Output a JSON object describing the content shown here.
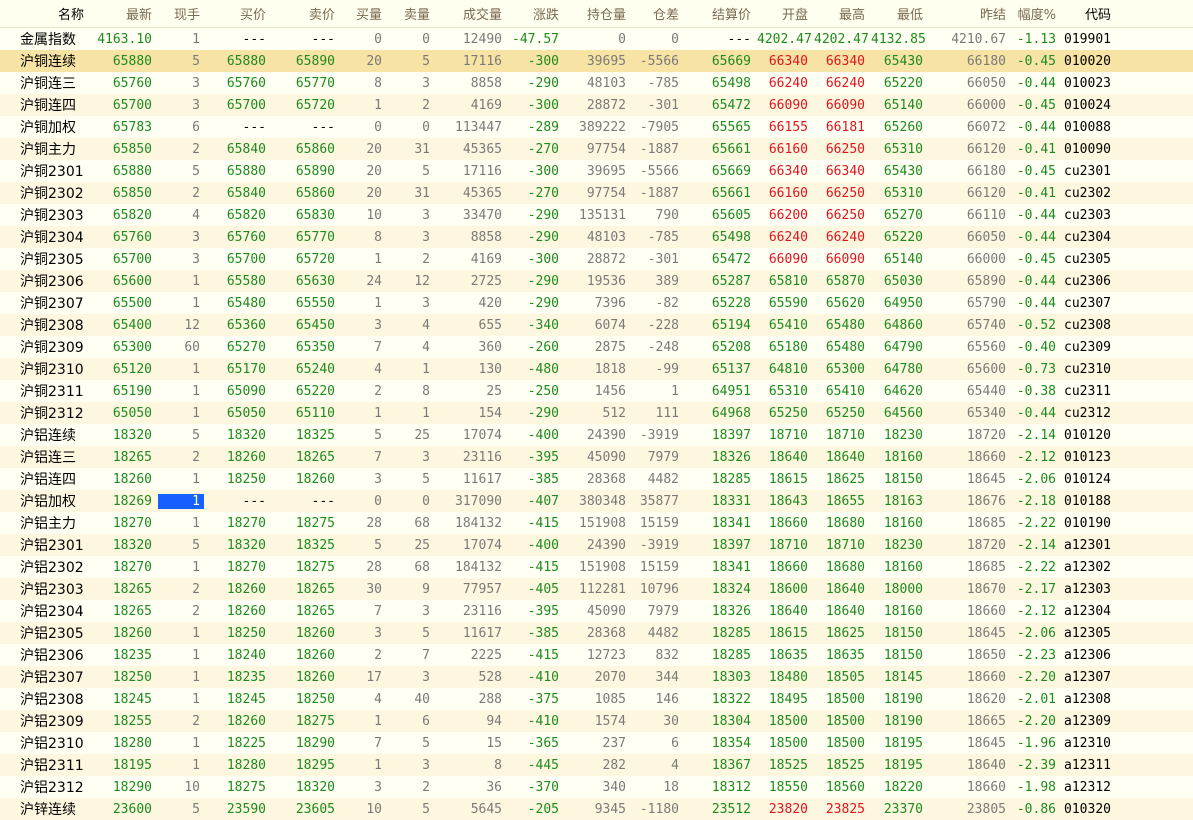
{
  "columns": [
    "名称",
    "最新",
    "现手",
    "买价",
    "卖价",
    "买量",
    "卖量",
    "成交量",
    "涨跌",
    "持仓量",
    "仓差",
    "结算价",
    "开盘",
    "最高",
    "最低",
    "昨结",
    "幅度%",
    "代码"
  ],
  "rows": [
    {
      "name": "金属指数",
      "last": "4163.10",
      "vol_now": "1",
      "bid": "---",
      "ask": "---",
      "bid_qty": "0",
      "ask_qty": "0",
      "volume": "12490",
      "change": "-47.57",
      "oi": "0",
      "oi_diff": "0",
      "settle": "---",
      "open": "4202.47",
      "high": "4202.47",
      "low": "4132.85",
      "prev_settle": "4210.67",
      "pct": "-1.13",
      "code": "019901"
    },
    {
      "name": "沪铜连续",
      "last": "65880",
      "vol_now": "5",
      "bid": "65880",
      "ask": "65890",
      "bid_qty": "20",
      "ask_qty": "5",
      "volume": "17116",
      "change": "-300",
      "oi": "39695",
      "oi_diff": "-5566",
      "settle": "65669",
      "open": "66340",
      "high": "66340",
      "low": "65430",
      "prev_settle": "66180",
      "pct": "-0.45",
      "code": "010020"
    },
    {
      "name": "沪铜连三",
      "last": "65760",
      "vol_now": "3",
      "bid": "65760",
      "ask": "65770",
      "bid_qty": "8",
      "ask_qty": "3",
      "volume": "8858",
      "change": "-290",
      "oi": "48103",
      "oi_diff": "-785",
      "settle": "65498",
      "open": "66240",
      "high": "66240",
      "low": "65220",
      "prev_settle": "66050",
      "pct": "-0.44",
      "code": "010023"
    },
    {
      "name": "沪铜连四",
      "last": "65700",
      "vol_now": "3",
      "bid": "65700",
      "ask": "65720",
      "bid_qty": "1",
      "ask_qty": "2",
      "volume": "4169",
      "change": "-300",
      "oi": "28872",
      "oi_diff": "-301",
      "settle": "65472",
      "open": "66090",
      "high": "66090",
      "low": "65140",
      "prev_settle": "66000",
      "pct": "-0.45",
      "code": "010024"
    },
    {
      "name": "沪铜加权",
      "last": "65783",
      "vol_now": "6",
      "bid": "---",
      "ask": "---",
      "bid_qty": "0",
      "ask_qty": "0",
      "volume": "113447",
      "change": "-289",
      "oi": "389222",
      "oi_diff": "-7905",
      "settle": "65565",
      "open": "66155",
      "high": "66181",
      "low": "65260",
      "prev_settle": "66072",
      "pct": "-0.44",
      "code": "010088"
    },
    {
      "name": "沪铜主力",
      "last": "65850",
      "vol_now": "2",
      "bid": "65840",
      "ask": "65860",
      "bid_qty": "20",
      "ask_qty": "31",
      "volume": "45365",
      "change": "-270",
      "oi": "97754",
      "oi_diff": "-1887",
      "settle": "65661",
      "open": "66160",
      "high": "66250",
      "low": "65310",
      "prev_settle": "66120",
      "pct": "-0.41",
      "code": "010090"
    },
    {
      "name": "沪铜2301",
      "last": "65880",
      "vol_now": "5",
      "bid": "65880",
      "ask": "65890",
      "bid_qty": "20",
      "ask_qty": "5",
      "volume": "17116",
      "change": "-300",
      "oi": "39695",
      "oi_diff": "-5566",
      "settle": "65669",
      "open": "66340",
      "high": "66340",
      "low": "65430",
      "prev_settle": "66180",
      "pct": "-0.45",
      "code": "cu2301"
    },
    {
      "name": "沪铜2302",
      "last": "65850",
      "vol_now": "2",
      "bid": "65840",
      "ask": "65860",
      "bid_qty": "20",
      "ask_qty": "31",
      "volume": "45365",
      "change": "-270",
      "oi": "97754",
      "oi_diff": "-1887",
      "settle": "65661",
      "open": "66160",
      "high": "66250",
      "low": "65310",
      "prev_settle": "66120",
      "pct": "-0.41",
      "code": "cu2302"
    },
    {
      "name": "沪铜2303",
      "last": "65820",
      "vol_now": "4",
      "bid": "65820",
      "ask": "65830",
      "bid_qty": "10",
      "ask_qty": "3",
      "volume": "33470",
      "change": "-290",
      "oi": "135131",
      "oi_diff": "790",
      "settle": "65605",
      "open": "66200",
      "high": "66250",
      "low": "65270",
      "prev_settle": "66110",
      "pct": "-0.44",
      "code": "cu2303"
    },
    {
      "name": "沪铜2304",
      "last": "65760",
      "vol_now": "3",
      "bid": "65760",
      "ask": "65770",
      "bid_qty": "8",
      "ask_qty": "3",
      "volume": "8858",
      "change": "-290",
      "oi": "48103",
      "oi_diff": "-785",
      "settle": "65498",
      "open": "66240",
      "high": "66240",
      "low": "65220",
      "prev_settle": "66050",
      "pct": "-0.44",
      "code": "cu2304"
    },
    {
      "name": "沪铜2305",
      "last": "65700",
      "vol_now": "3",
      "bid": "65700",
      "ask": "65720",
      "bid_qty": "1",
      "ask_qty": "2",
      "volume": "4169",
      "change": "-300",
      "oi": "28872",
      "oi_diff": "-301",
      "settle": "65472",
      "open": "66090",
      "high": "66090",
      "low": "65140",
      "prev_settle": "66000",
      "pct": "-0.45",
      "code": "cu2305"
    },
    {
      "name": "沪铜2306",
      "last": "65600",
      "vol_now": "1",
      "bid": "65580",
      "ask": "65630",
      "bid_qty": "24",
      "ask_qty": "12",
      "volume": "2725",
      "change": "-290",
      "oi": "19536",
      "oi_diff": "389",
      "settle": "65287",
      "open": "65810",
      "high": "65870",
      "low": "65030",
      "prev_settle": "65890",
      "pct": "-0.44",
      "code": "cu2306"
    },
    {
      "name": "沪铜2307",
      "last": "65500",
      "vol_now": "1",
      "bid": "65480",
      "ask": "65550",
      "bid_qty": "1",
      "ask_qty": "3",
      "volume": "420",
      "change": "-290",
      "oi": "7396",
      "oi_diff": "-82",
      "settle": "65228",
      "open": "65590",
      "high": "65620",
      "low": "64950",
      "prev_settle": "65790",
      "pct": "-0.44",
      "code": "cu2307"
    },
    {
      "name": "沪铜2308",
      "last": "65400",
      "vol_now": "12",
      "bid": "65360",
      "ask": "65450",
      "bid_qty": "3",
      "ask_qty": "4",
      "volume": "655",
      "change": "-340",
      "oi": "6074",
      "oi_diff": "-228",
      "settle": "65194",
      "open": "65410",
      "high": "65480",
      "low": "64860",
      "prev_settle": "65740",
      "pct": "-0.52",
      "code": "cu2308"
    },
    {
      "name": "沪铜2309",
      "last": "65300",
      "vol_now": "60",
      "bid": "65270",
      "ask": "65350",
      "bid_qty": "7",
      "ask_qty": "4",
      "volume": "360",
      "change": "-260",
      "oi": "2875",
      "oi_diff": "-248",
      "settle": "65208",
      "open": "65180",
      "high": "65480",
      "low": "64790",
      "prev_settle": "65560",
      "pct": "-0.40",
      "code": "cu2309"
    },
    {
      "name": "沪铜2310",
      "last": "65120",
      "vol_now": "1",
      "bid": "65170",
      "ask": "65240",
      "bid_qty": "4",
      "ask_qty": "1",
      "volume": "130",
      "change": "-480",
      "oi": "1818",
      "oi_diff": "-99",
      "settle": "65137",
      "open": "64810",
      "high": "65300",
      "low": "64780",
      "prev_settle": "65600",
      "pct": "-0.73",
      "code": "cu2310"
    },
    {
      "name": "沪铜2311",
      "last": "65190",
      "vol_now": "1",
      "bid": "65090",
      "ask": "65220",
      "bid_qty": "2",
      "ask_qty": "8",
      "volume": "25",
      "change": "-250",
      "oi": "1456",
      "oi_diff": "1",
      "settle": "64951",
      "open": "65310",
      "high": "65410",
      "low": "64620",
      "prev_settle": "65440",
      "pct": "-0.38",
      "code": "cu2311"
    },
    {
      "name": "沪铜2312",
      "last": "65050",
      "vol_now": "1",
      "bid": "65050",
      "ask": "65110",
      "bid_qty": "1",
      "ask_qty": "1",
      "volume": "154",
      "change": "-290",
      "oi": "512",
      "oi_diff": "111",
      "settle": "64968",
      "open": "65250",
      "high": "65250",
      "low": "64560",
      "prev_settle": "65340",
      "pct": "-0.44",
      "code": "cu2312"
    },
    {
      "name": "沪铝连续",
      "last": "18320",
      "vol_now": "5",
      "bid": "18320",
      "ask": "18325",
      "bid_qty": "5",
      "ask_qty": "25",
      "volume": "17074",
      "change": "-400",
      "oi": "24390",
      "oi_diff": "-3919",
      "settle": "18397",
      "open": "18710",
      "high": "18710",
      "low": "18230",
      "prev_settle": "18720",
      "pct": "-2.14",
      "code": "010120"
    },
    {
      "name": "沪铝连三",
      "last": "18265",
      "vol_now": "2",
      "bid": "18260",
      "ask": "18265",
      "bid_qty": "7",
      "ask_qty": "3",
      "volume": "23116",
      "change": "-395",
      "oi": "45090",
      "oi_diff": "7979",
      "settle": "18326",
      "open": "18640",
      "high": "18640",
      "low": "18160",
      "prev_settle": "18660",
      "pct": "-2.12",
      "code": "010123"
    },
    {
      "name": "沪铝连四",
      "last": "18260",
      "vol_now": "1",
      "bid": "18250",
      "ask": "18260",
      "bid_qty": "3",
      "ask_qty": "5",
      "volume": "11617",
      "change": "-385",
      "oi": "28368",
      "oi_diff": "4482",
      "settle": "18285",
      "open": "18615",
      "high": "18625",
      "low": "18150",
      "prev_settle": "18645",
      "pct": "-2.06",
      "code": "010124"
    },
    {
      "name": "沪铝加权",
      "last": "18269",
      "vol_now": "1",
      "bid": "---",
      "ask": "---",
      "bid_qty": "0",
      "ask_qty": "0",
      "volume": "317090",
      "change": "-407",
      "oi": "380348",
      "oi_diff": "35877",
      "settle": "18331",
      "open": "18643",
      "high": "18655",
      "low": "18163",
      "prev_settle": "18676",
      "pct": "-2.18",
      "code": "010188"
    },
    {
      "name": "沪铝主力",
      "last": "18270",
      "vol_now": "1",
      "bid": "18270",
      "ask": "18275",
      "bid_qty": "28",
      "ask_qty": "68",
      "volume": "184132",
      "change": "-415",
      "oi": "151908",
      "oi_diff": "15159",
      "settle": "18341",
      "open": "18660",
      "high": "18680",
      "low": "18160",
      "prev_settle": "18685",
      "pct": "-2.22",
      "code": "010190"
    },
    {
      "name": "沪铝2301",
      "last": "18320",
      "vol_now": "5",
      "bid": "18320",
      "ask": "18325",
      "bid_qty": "5",
      "ask_qty": "25",
      "volume": "17074",
      "change": "-400",
      "oi": "24390",
      "oi_diff": "-3919",
      "settle": "18397",
      "open": "18710",
      "high": "18710",
      "low": "18230",
      "prev_settle": "18720",
      "pct": "-2.14",
      "code": "a12301"
    },
    {
      "name": "沪铝2302",
      "last": "18270",
      "vol_now": "1",
      "bid": "18270",
      "ask": "18275",
      "bid_qty": "28",
      "ask_qty": "68",
      "volume": "184132",
      "change": "-415",
      "oi": "151908",
      "oi_diff": "15159",
      "settle": "18341",
      "open": "18660",
      "high": "18680",
      "low": "18160",
      "prev_settle": "18685",
      "pct": "-2.22",
      "code": "a12302"
    },
    {
      "name": "沪铝2303",
      "last": "18265",
      "vol_now": "2",
      "bid": "18260",
      "ask": "18265",
      "bid_qty": "30",
      "ask_qty": "9",
      "volume": "77957",
      "change": "-405",
      "oi": "112281",
      "oi_diff": "10796",
      "settle": "18324",
      "open": "18600",
      "high": "18640",
      "low": "18000",
      "prev_settle": "18670",
      "pct": "-2.17",
      "code": "a12303"
    },
    {
      "name": "沪铝2304",
      "last": "18265",
      "vol_now": "2",
      "bid": "18260",
      "ask": "18265",
      "bid_qty": "7",
      "ask_qty": "3",
      "volume": "23116",
      "change": "-395",
      "oi": "45090",
      "oi_diff": "7979",
      "settle": "18326",
      "open": "18640",
      "high": "18640",
      "low": "18160",
      "prev_settle": "18660",
      "pct": "-2.12",
      "code": "a12304"
    },
    {
      "name": "沪铝2305",
      "last": "18260",
      "vol_now": "1",
      "bid": "18250",
      "ask": "18260",
      "bid_qty": "3",
      "ask_qty": "5",
      "volume": "11617",
      "change": "-385",
      "oi": "28368",
      "oi_diff": "4482",
      "settle": "18285",
      "open": "18615",
      "high": "18625",
      "low": "18150",
      "prev_settle": "18645",
      "pct": "-2.06",
      "code": "a12305"
    },
    {
      "name": "沪铝2306",
      "last": "18235",
      "vol_now": "1",
      "bid": "18240",
      "ask": "18260",
      "bid_qty": "2",
      "ask_qty": "7",
      "volume": "2225",
      "change": "-415",
      "oi": "12723",
      "oi_diff": "832",
      "settle": "18285",
      "open": "18635",
      "high": "18635",
      "low": "18150",
      "prev_settle": "18650",
      "pct": "-2.23",
      "code": "a12306"
    },
    {
      "name": "沪铝2307",
      "last": "18250",
      "vol_now": "1",
      "bid": "18235",
      "ask": "18260",
      "bid_qty": "17",
      "ask_qty": "3",
      "volume": "528",
      "change": "-410",
      "oi": "2070",
      "oi_diff": "344",
      "settle": "18303",
      "open": "18480",
      "high": "18505",
      "low": "18145",
      "prev_settle": "18660",
      "pct": "-2.20",
      "code": "a12307"
    },
    {
      "name": "沪铝2308",
      "last": "18245",
      "vol_now": "1",
      "bid": "18245",
      "ask": "18250",
      "bid_qty": "4",
      "ask_qty": "40",
      "volume": "288",
      "change": "-375",
      "oi": "1085",
      "oi_diff": "146",
      "settle": "18322",
      "open": "18495",
      "high": "18500",
      "low": "18190",
      "prev_settle": "18620",
      "pct": "-2.01",
      "code": "a12308"
    },
    {
      "name": "沪铝2309",
      "last": "18255",
      "vol_now": "2",
      "bid": "18260",
      "ask": "18275",
      "bid_qty": "1",
      "ask_qty": "6",
      "volume": "94",
      "change": "-410",
      "oi": "1574",
      "oi_diff": "30",
      "settle": "18304",
      "open": "18500",
      "high": "18500",
      "low": "18190",
      "prev_settle": "18665",
      "pct": "-2.20",
      "code": "a12309"
    },
    {
      "name": "沪铝2310",
      "last": "18280",
      "vol_now": "1",
      "bid": "18225",
      "ask": "18290",
      "bid_qty": "7",
      "ask_qty": "5",
      "volume": "15",
      "change": "-365",
      "oi": "237",
      "oi_diff": "6",
      "settle": "18354",
      "open": "18500",
      "high": "18500",
      "low": "18195",
      "prev_settle": "18645",
      "pct": "-1.96",
      "code": "a12310"
    },
    {
      "name": "沪铝2311",
      "last": "18195",
      "vol_now": "1",
      "bid": "18280",
      "ask": "18295",
      "bid_qty": "1",
      "ask_qty": "3",
      "volume": "8",
      "change": "-445",
      "oi": "282",
      "oi_diff": "4",
      "settle": "18367",
      "open": "18525",
      "high": "18525",
      "low": "18195",
      "prev_settle": "18640",
      "pct": "-2.39",
      "code": "a12311"
    },
    {
      "name": "沪铝2312",
      "last": "18290",
      "vol_now": "10",
      "bid": "18275",
      "ask": "18320",
      "bid_qty": "3",
      "ask_qty": "2",
      "volume": "36",
      "change": "-370",
      "oi": "340",
      "oi_diff": "18",
      "settle": "18312",
      "open": "18550",
      "high": "18560",
      "low": "18220",
      "prev_settle": "18660",
      "pct": "-1.98",
      "code": "a12312"
    },
    {
      "name": "沪锌连续",
      "last": "23600",
      "vol_now": "5",
      "bid": "23590",
      "ask": "23605",
      "bid_qty": "10",
      "ask_qty": "5",
      "volume": "5645",
      "change": "-205",
      "oi": "9345",
      "oi_diff": "-1180",
      "settle": "23512",
      "open": "23820",
      "high": "23825",
      "low": "23370",
      "prev_settle": "23805",
      "pct": "-0.86",
      "code": "010320"
    }
  ],
  "selected_row": 1,
  "highlighted_cell": {
    "row": 21,
    "field": "vol_now"
  },
  "colors": {
    "up": "#E0141E",
    "down": "#1E8A1E",
    "neutral": "#000000",
    "muted": "#7A7A7A",
    "highlight": "#1560FF"
  }
}
